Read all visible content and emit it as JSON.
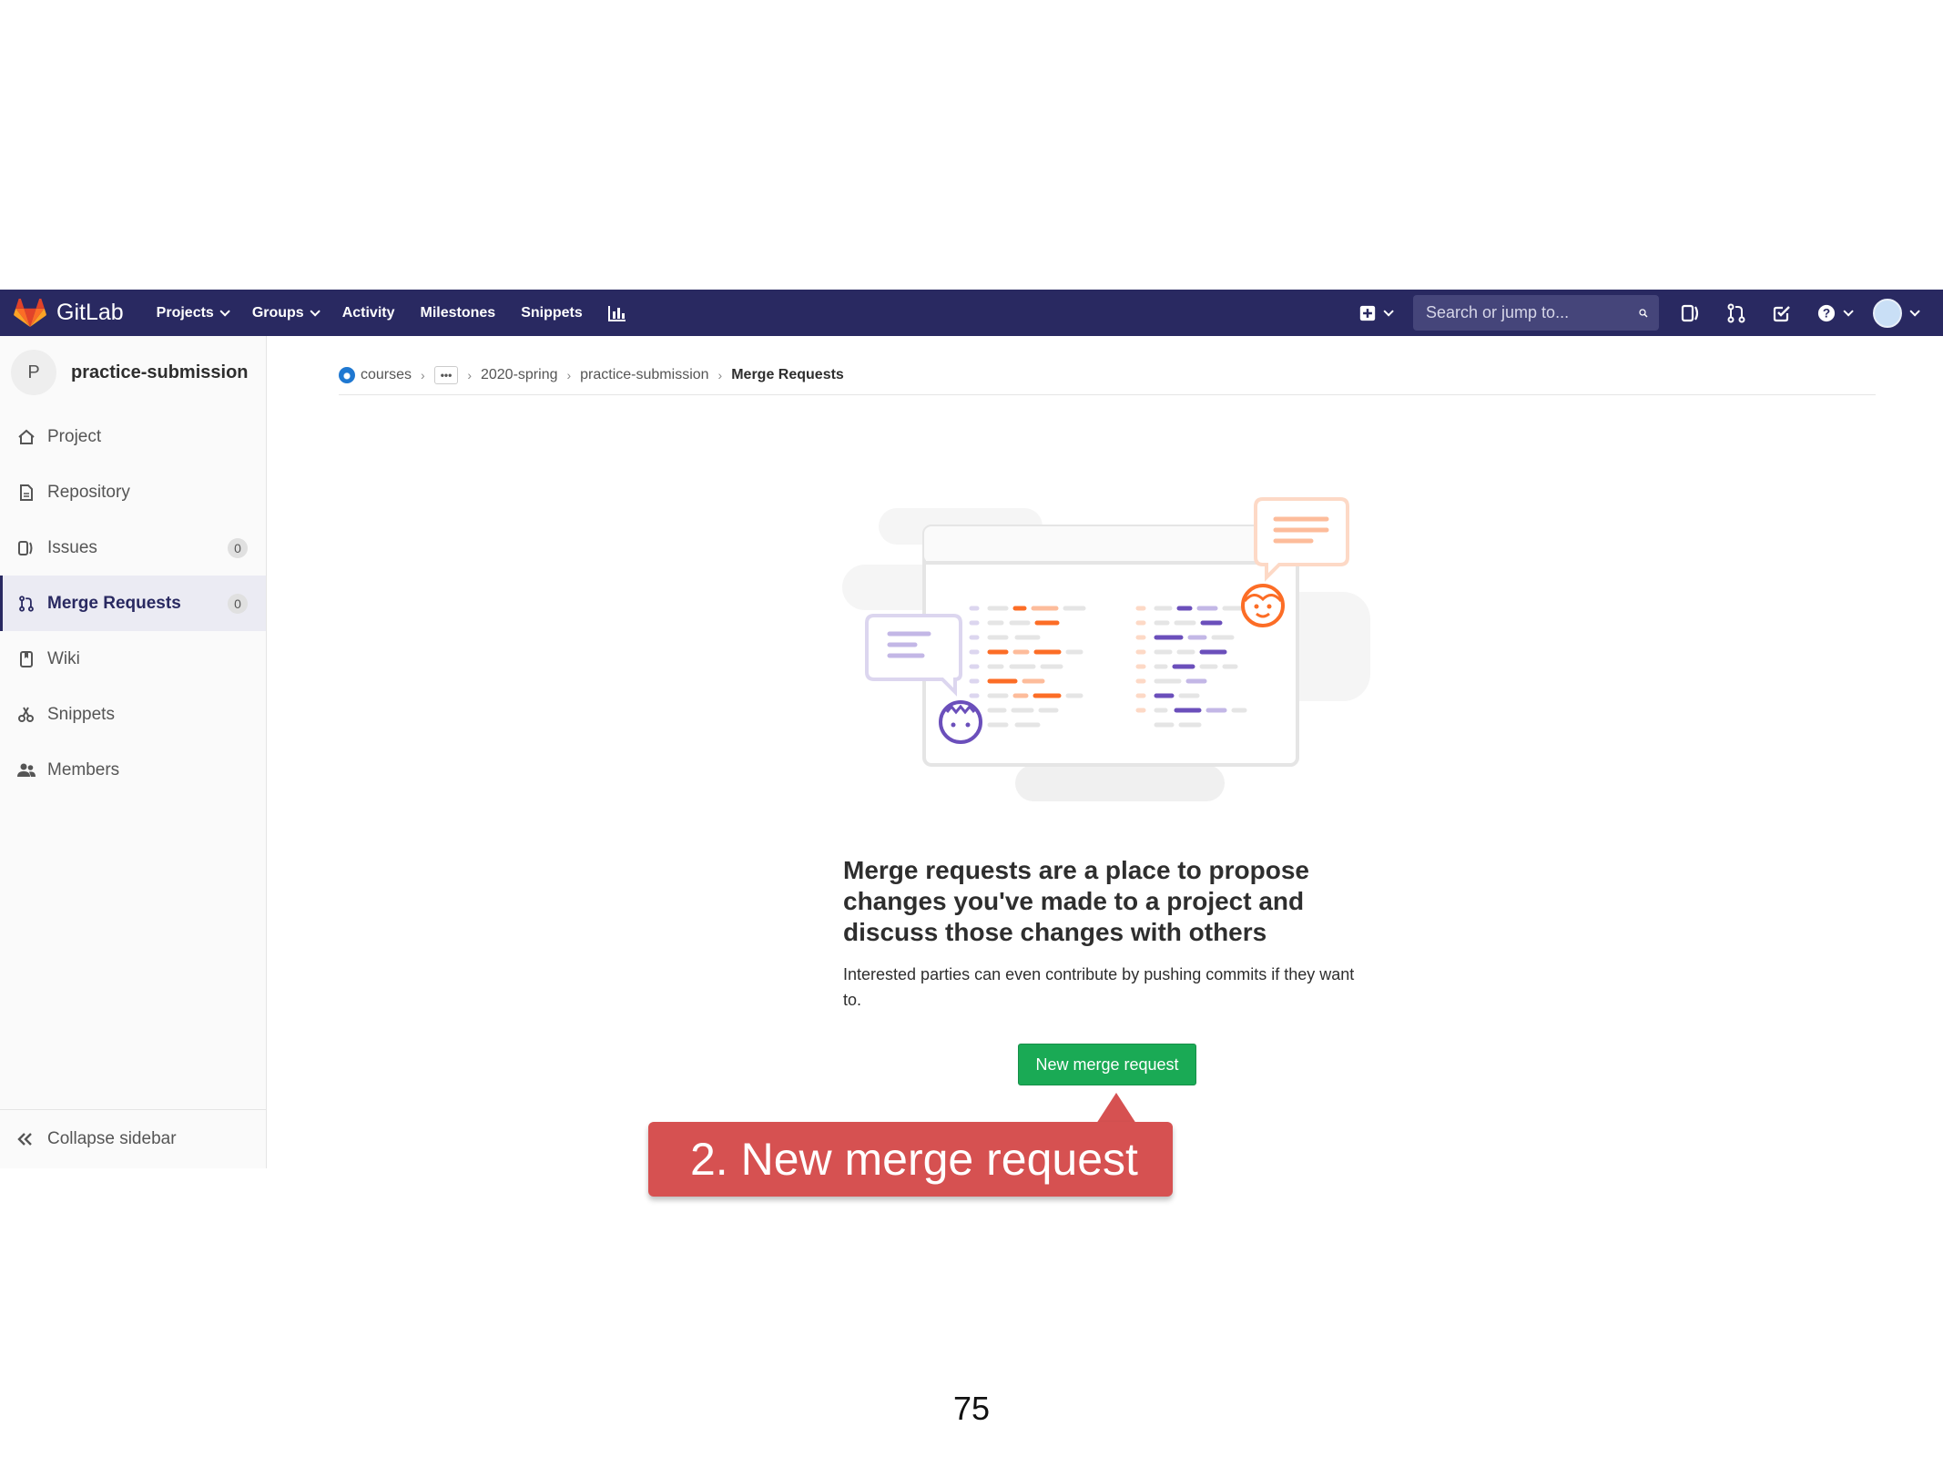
{
  "navbar": {
    "brand": "GitLab",
    "links": [
      {
        "label": "Projects",
        "dropdown": true
      },
      {
        "label": "Groups",
        "dropdown": true
      },
      {
        "label": "Activity",
        "dropdown": false
      },
      {
        "label": "Milestones",
        "dropdown": false
      },
      {
        "label": "Snippets",
        "dropdown": false
      }
    ],
    "search_placeholder": "Search or jump to..."
  },
  "sidebar": {
    "project_initial": "P",
    "project_name": "practice-submission",
    "items": [
      {
        "label": "Project",
        "icon": "home-icon"
      },
      {
        "label": "Repository",
        "icon": "document-icon"
      },
      {
        "label": "Issues",
        "icon": "issues-icon",
        "count": "0"
      },
      {
        "label": "Merge Requests",
        "icon": "merge-request-icon",
        "count": "0",
        "active": true
      },
      {
        "label": "Wiki",
        "icon": "book-icon"
      },
      {
        "label": "Snippets",
        "icon": "scissors-icon"
      },
      {
        "label": "Members",
        "icon": "users-icon"
      }
    ],
    "collapse_label": "Collapse sidebar"
  },
  "breadcrumb": {
    "items": [
      "courses",
      "2020-spring",
      "practice-submission",
      "Merge Requests"
    ],
    "ellipsis": "•••"
  },
  "empty_state": {
    "title": "Merge requests are a place to propose changes you've made to a project and discuss those changes with others",
    "text": "Interested parties can even contribute by pushing commits if they want to.",
    "button": "New merge request"
  },
  "callout": {
    "text": "2. New merge request"
  },
  "page_number": "75",
  "colors": {
    "navbar": "#292961",
    "button": "#1aaa55",
    "callout": "#d65151",
    "accent_orange": "#fc6d26",
    "accent_purple": "#6b4fbb"
  }
}
